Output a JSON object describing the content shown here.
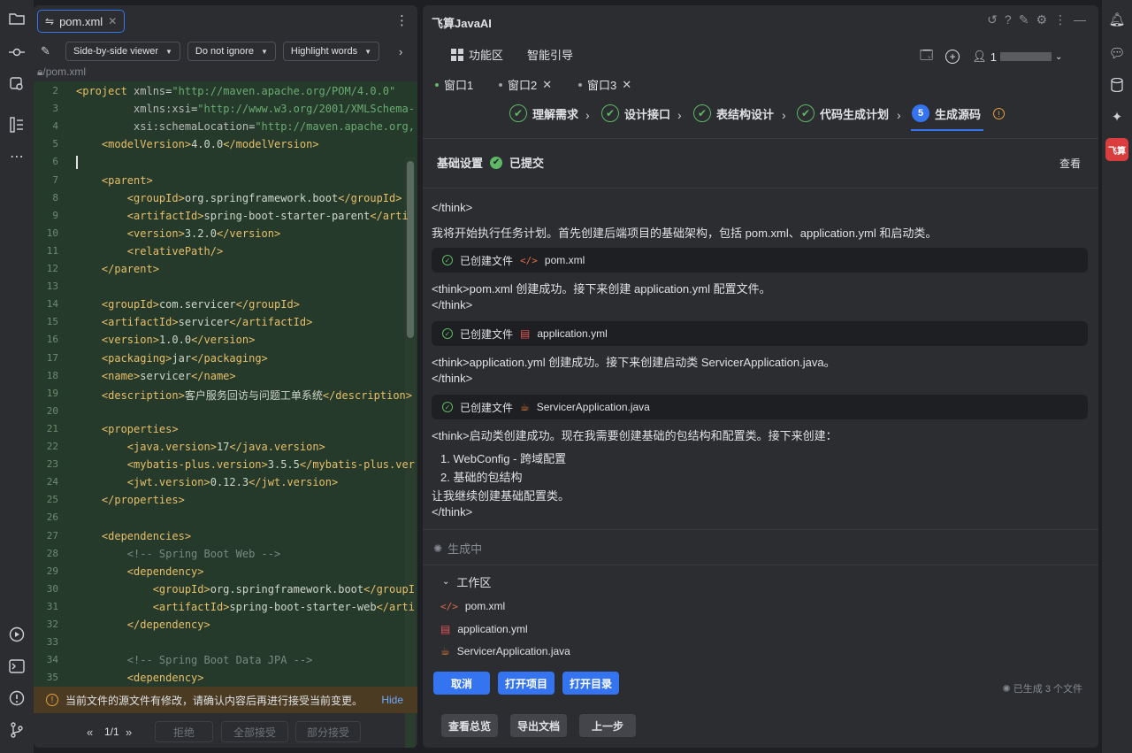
{
  "left_strip": {
    "icons": [
      "folder-icon",
      "commit-icon",
      "vcs-icon",
      "structure-icon",
      "more-icon",
      "run-icon",
      "terminal-icon",
      "problems-icon",
      "git-icon"
    ]
  },
  "editor": {
    "tab": "pom.xml",
    "toolbar": {
      "viewer": "Side-by-side viewer",
      "ignore": "Do not ignore",
      "highlight": "Highlight words"
    },
    "path": "/pom.xml",
    "lines": [
      {
        "n": "2",
        "t": "<project xmlns=\"http://maven.apache.org/POM/4.0.0\""
      },
      {
        "n": "3",
        "t": "         xmlns:xsi=\"http://www.w3.org/2001/XMLSchema-"
      },
      {
        "n": "4",
        "t": "         xsi:schemaLocation=\"http://maven.apache.org,"
      },
      {
        "n": "5",
        "t": "    <modelVersion>4.0.0</modelVersion>"
      },
      {
        "n": "6",
        "t": ""
      },
      {
        "n": "7",
        "t": "    <parent>"
      },
      {
        "n": "8",
        "t": "        <groupId>org.springframework.boot</groupId>"
      },
      {
        "n": "9",
        "t": "        <artifactId>spring-boot-starter-parent</arti"
      },
      {
        "n": "10",
        "t": "        <version>3.2.0</version>"
      },
      {
        "n": "11",
        "t": "        <relativePath/>"
      },
      {
        "n": "12",
        "t": "    </parent>"
      },
      {
        "n": "13",
        "t": ""
      },
      {
        "n": "14",
        "t": "    <groupId>com.servicer</groupId>"
      },
      {
        "n": "15",
        "t": "    <artifactId>servicer</artifactId>"
      },
      {
        "n": "16",
        "t": "    <version>1.0.0</version>"
      },
      {
        "n": "17",
        "t": "    <packaging>jar</packaging>"
      },
      {
        "n": "18",
        "t": "    <name>servicer</name>"
      },
      {
        "n": "19",
        "t": "    <description>客户服务回访与问题工单系统</description>"
      },
      {
        "n": "20",
        "t": ""
      },
      {
        "n": "21",
        "t": "    <properties>"
      },
      {
        "n": "22",
        "t": "        <java.version>17</java.version>"
      },
      {
        "n": "23",
        "t": "        <mybatis-plus.version>3.5.5</mybatis-plus.ver"
      },
      {
        "n": "24",
        "t": "        <jwt.version>0.12.3</jwt.version>"
      },
      {
        "n": "25",
        "t": "    </properties>"
      },
      {
        "n": "26",
        "t": ""
      },
      {
        "n": "27",
        "t": "    <dependencies>"
      },
      {
        "n": "28",
        "t": "        <!-- Spring Boot Web -->"
      },
      {
        "n": "29",
        "t": "        <dependency>"
      },
      {
        "n": "30",
        "t": "            <groupId>org.springframework.boot</groupI"
      },
      {
        "n": "31",
        "t": "            <artifactId>spring-boot-starter-web</arti"
      },
      {
        "n": "32",
        "t": "        </dependency>"
      },
      {
        "n": "33",
        "t": ""
      },
      {
        "n": "34",
        "t": "        <!-- Spring Boot Data JPA -->"
      },
      {
        "n": "35",
        "t": "        <dependency>"
      }
    ],
    "warning": "当前文件的源文件有修改，请确认内容后再进行接受当前变更。",
    "hide": "Hide",
    "pager": "1/1",
    "buttons": {
      "reject": "拒绝",
      "accept_all": "全部接受",
      "partial_accept": "部分接受"
    }
  },
  "assistant": {
    "title": "飞算JavaAI",
    "menu": {
      "features": "功能区",
      "guide": "智能引导",
      "user": "1"
    },
    "windows": [
      "窗口1",
      "窗口2",
      "窗口3"
    ],
    "steps": [
      "理解需求",
      "设计接口",
      "表结构设计",
      "代码生成计划",
      "生成源码"
    ],
    "step_number": "5",
    "basic_settings": "基础设置",
    "submitted": "已提交",
    "view": "查看",
    "messages": {
      "m0": "</think>",
      "m1": "我将开始执行任务计划。首先创建后端项目的基础架构，包括 pom.xml、application.yml 和启动类。",
      "m2": "<think>pom.xml 创建成功。接下来创建 application.yml 配置文件。",
      "m3": "</think>",
      "m4": "<think>application.yml 创建成功。接下来创建启动类 ServicerApplication.java。",
      "m5": "</think>",
      "m6": "<think>启动类创建成功。现在我需要创建基础的包结构和配置类。接下来创建：",
      "li1": "WebConfig - 跨域配置",
      "li2": "基础的包结构",
      "m7": "让我继续创建基础配置类。",
      "m8": "</think>"
    },
    "created_label": "已创建文件",
    "files": [
      "pom.xml",
      "application.yml",
      "ServicerApplication.java"
    ],
    "generating": "生成中",
    "workspace": "工作区",
    "buttons": {
      "cancel": "取消",
      "open_project": "打开项目",
      "open_dir": "打开目录",
      "overview": "查看总览",
      "export_doc": "导出文档",
      "prev": "上一步"
    },
    "gen_count": "已生成 3 个文件"
  },
  "right_strip": {
    "badge": "飞算"
  },
  "colors": {
    "accent": "#3574f0",
    "success": "#5fb865",
    "code_bg": "#253a2a"
  }
}
